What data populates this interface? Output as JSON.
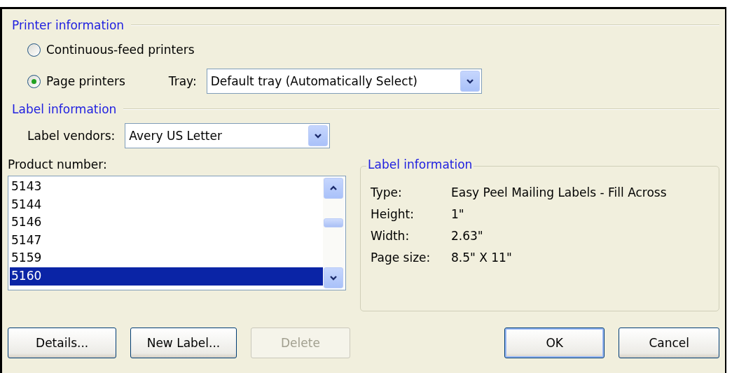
{
  "printer_information": {
    "title": "Printer information",
    "printer_types": [
      {
        "label": "Continuous-feed printers",
        "selected": false
      },
      {
        "label": "Page printers",
        "selected": true
      }
    ],
    "tray": {
      "label": "Tray:",
      "value": "Default tray (Automatically Select)"
    }
  },
  "label_information": {
    "title": "Label information",
    "vendors": {
      "label": "Label vendors:",
      "value": "Avery US Letter"
    }
  },
  "product_number": {
    "label": "Product number:",
    "items": [
      {
        "label": "5143",
        "selected": false
      },
      {
        "label": "5144",
        "selected": false
      },
      {
        "label": "5146",
        "selected": false
      },
      {
        "label": "5147",
        "selected": false
      },
      {
        "label": "5159",
        "selected": false
      },
      {
        "label": "5160",
        "selected": true
      }
    ]
  },
  "label_details": {
    "title": "Label information",
    "rows": [
      {
        "name": "Type:",
        "value": "Easy Peel Mailing Labels - Fill Across"
      },
      {
        "name": "Height:",
        "value": "1\""
      },
      {
        "name": "Width:",
        "value": "2.63\""
      },
      {
        "name": "Page size:",
        "value": "8.5\" X 11\""
      }
    ]
  },
  "buttons": [
    {
      "label": "Details...",
      "disabled": false,
      "default": false
    },
    {
      "label": "New Label...",
      "disabled": false,
      "default": false
    },
    {
      "label": "Delete",
      "disabled": true,
      "default": false
    },
    {
      "label": "OK",
      "disabled": false,
      "default": true
    },
    {
      "label": "Cancel",
      "disabled": false,
      "default": false
    }
  ]
}
